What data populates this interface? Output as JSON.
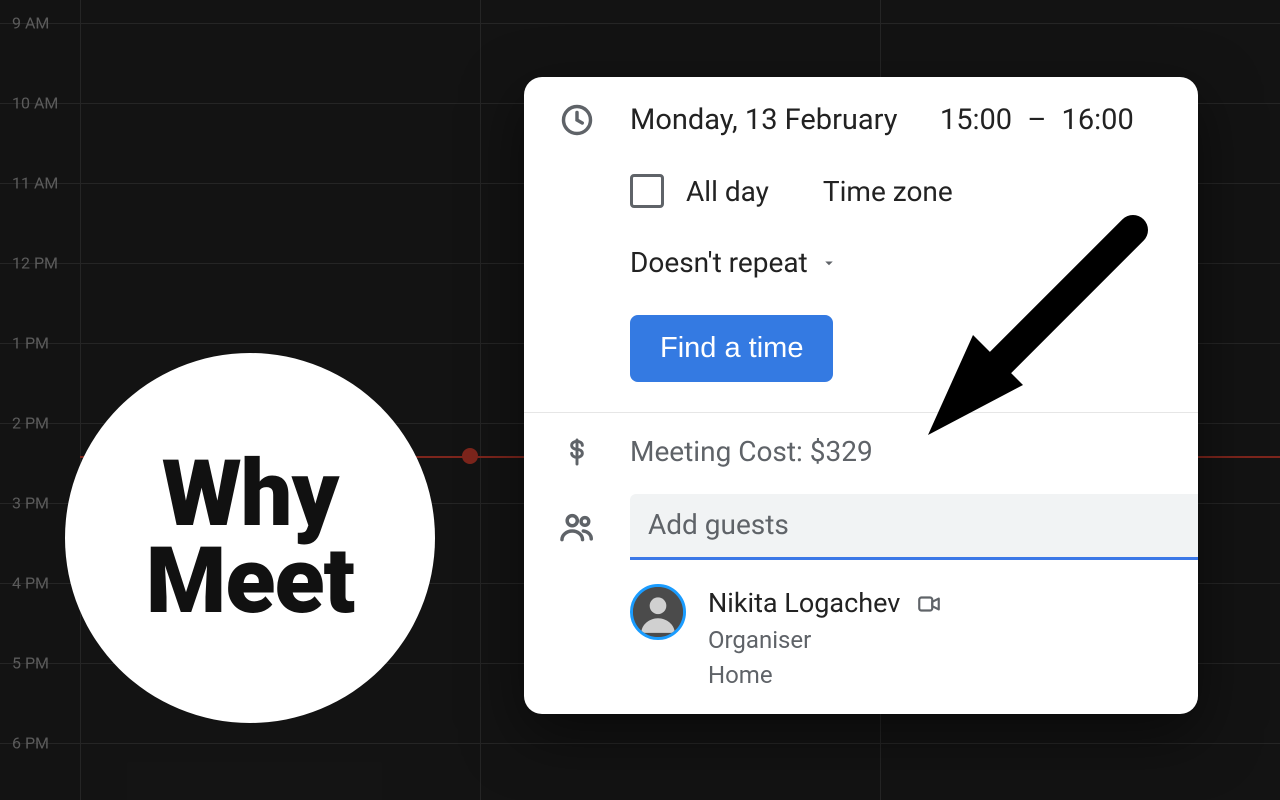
{
  "calendar": {
    "time_labels": [
      "9 AM",
      "10 AM",
      "11 AM",
      "12 PM",
      "1 PM",
      "2 PM",
      "3 PM",
      "4 PM",
      "5 PM",
      "6 PM"
    ]
  },
  "badge": {
    "line1": "Why",
    "line2": "Meet"
  },
  "event": {
    "date": "Monday, 13 February",
    "start_time": "15:00",
    "end_time": "16:00",
    "all_day_label": "All day",
    "time_zone_label": "Time zone",
    "repeat_label": "Doesn't repeat",
    "find_time_label": "Find a time",
    "cost_label": "Meeting Cost: $329",
    "add_guests_placeholder": "Add guests",
    "guest": {
      "name": "Nikita Logachev",
      "role": "Organiser",
      "location": "Home"
    }
  }
}
